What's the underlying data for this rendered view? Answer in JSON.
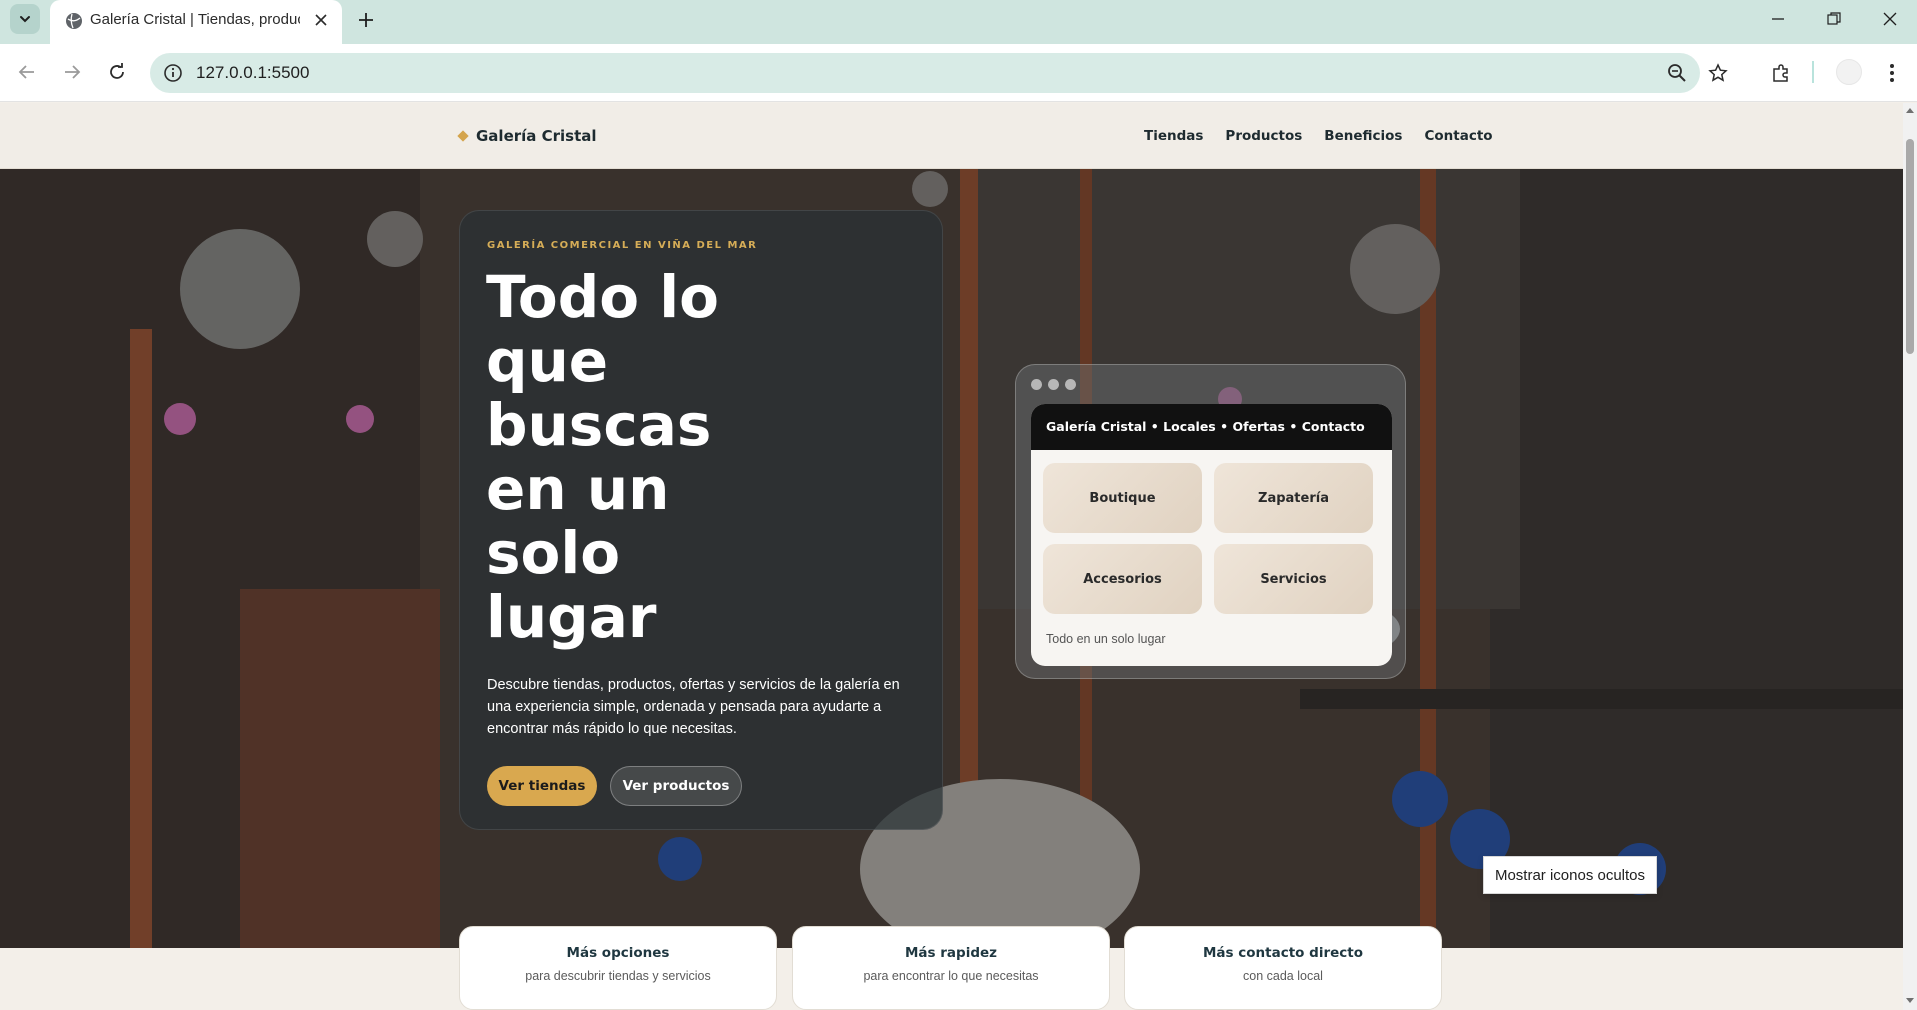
{
  "browser": {
    "tab_title": "Galería Cristal | Tiendas, produc",
    "url": "127.0.0.1:5500",
    "accent": "#cfe5df"
  },
  "site": {
    "brand": "Galería Cristal",
    "nav": [
      "Tiendas",
      "Productos",
      "Beneficios",
      "Contacto"
    ]
  },
  "hero": {
    "eyebrow": "GALERÍA COMERCIAL EN VIÑA DEL MAR",
    "title": "Todo lo que buscas en un solo lugar",
    "description": "Descubre tiendas, productos, ofertas y servicios de la galería en una experiencia simple, ordenada y pensada para ayudarte a encontrar más rápido lo que necesitas.",
    "primary_button": "Ver tiendas",
    "secondary_button": "Ver productos"
  },
  "mockup": {
    "bar_text": "Galería Cristal • Locales • Ofertas • Contacto",
    "tiles": [
      "Boutique",
      "Zapatería",
      "Accesorios",
      "Servicios"
    ],
    "footer": "Todo en un solo lugar"
  },
  "features": [
    {
      "title": "Más opciones",
      "subtitle": "para descubrir tiendas y servicios"
    },
    {
      "title": "Más rapidez",
      "subtitle": "para encontrar lo que necesitas"
    },
    {
      "title": "Más contacto directo",
      "subtitle": "con cada local"
    }
  ],
  "tooltip": "Mostrar iconos ocultos",
  "colors": {
    "gold": "#d9a84f",
    "dark_text": "#1e2b30",
    "header_bg": "#f1ede7"
  }
}
